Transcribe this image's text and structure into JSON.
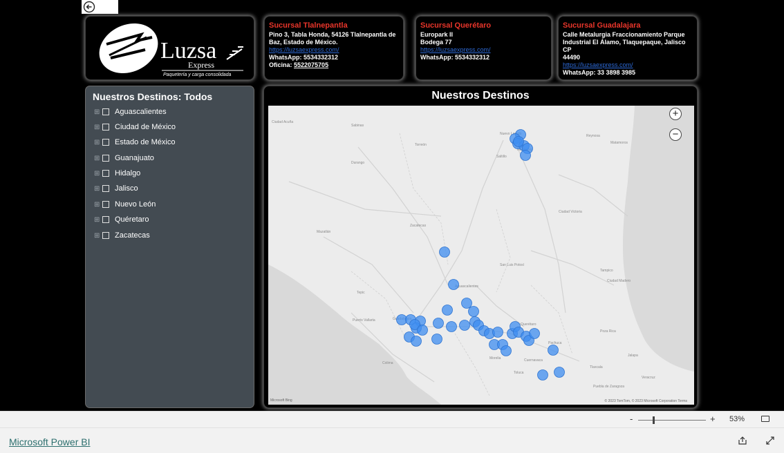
{
  "logo": {
    "name": "Luzsa",
    "sub": "Express",
    "tagline": "Paquetería y carga consolidada"
  },
  "branches": [
    {
      "title": "Sucursal Tlalnepantla",
      "lines": [
        "Pino 3, Tabla Honda, 54126 Tlalnepantla de",
        "Baz, Estado de México."
      ],
      "link": "https://luzsaexpress.com/",
      "whatsapp": "WhatsApp: 5534332312",
      "office_label": "Oficina: ",
      "office_number": "5522075705"
    },
    {
      "title": "Sucursal Querétaro",
      "lines": [
        "Europark II",
        "Bodega 77"
      ],
      "link": "https://luzsaexpress.com/",
      "whatsapp": "WhatsApp: 5534332312"
    },
    {
      "title": "Sucursal Guadalajara",
      "lines": [
        "Calle Metalurgia Fraccionamiento Parque",
        "Industrial El Álamo, Tlaquepaque, Jalisco CP",
        "44490"
      ],
      "link": "https://luzsaexpress.com/",
      "whatsapp": "WhatsApp: 33 3898 3985"
    }
  ],
  "filter": {
    "title": "Nuestros Destinos: Todos",
    "items": [
      "Aguascalientes",
      "Ciudad de México",
      "Estado de México",
      "Guanajuato",
      "Hidalgo",
      "Jalisco",
      "Nuevo León",
      "Quéretaro",
      "Zacatecas"
    ]
  },
  "map": {
    "title": "Nuestros Destinos",
    "zoom_in": "+",
    "zoom_out": "−",
    "attribution": "© 2023 TomTom, © 2023 Microsoft Corporation  Terms",
    "bing": "Microsoft Bing",
    "marker_color": "#3f8ef0",
    "labels": [
      "Ciudad Acuña",
      "Sabinas",
      "Nuevo Laredo",
      "Monterrey",
      "Saltillo",
      "Torreón",
      "Durango",
      "Zacatecas",
      "Aguascalientes",
      "San Luis Potosí",
      "Guadalajara",
      "Morelia",
      "Querétaro",
      "Toluca",
      "Pachuca",
      "Tampico",
      "Ciudad Victoria",
      "Reynosa",
      "Matamoros",
      "Mazatlán",
      "Tepic",
      "Puerto Vallarta",
      "Colima",
      "Ciudad Madero",
      "Poza Rica",
      "Tlaxcala",
      "Puebla de Zaragoza",
      "Cuernavaca",
      "Jalapa",
      "Veracruz"
    ]
  },
  "status": {
    "zoom_minus": "-",
    "zoom_plus": "+",
    "zoom_percent": "53%"
  },
  "footer": {
    "link": "Microsoft Power BI"
  }
}
